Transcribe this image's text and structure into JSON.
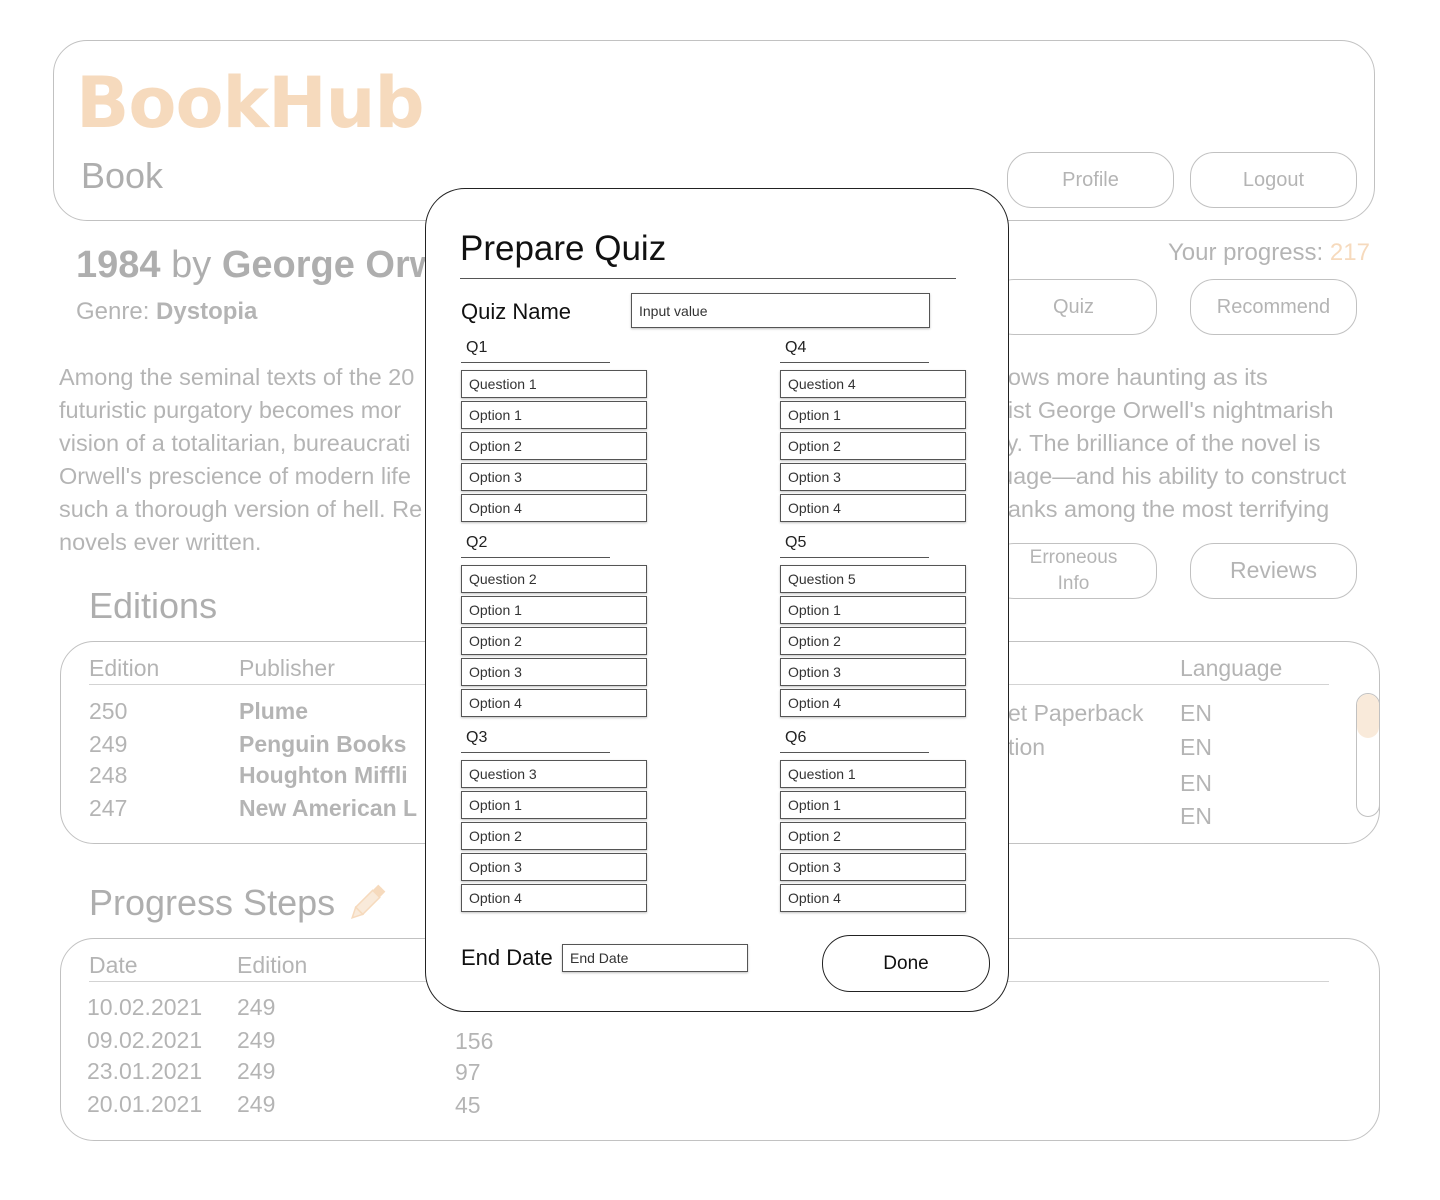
{
  "app": {
    "logo": "BookHub",
    "subtitle": "Book"
  },
  "header": {
    "profile_label": "Profile",
    "logout_label": "Logout"
  },
  "book": {
    "title": "1984",
    "by": "by",
    "author": "George Orw",
    "genre_label": "Genre:",
    "genre": "Dystopia",
    "progress_label": "Your progress:",
    "progress_value": "217",
    "description": [
      "Among the seminal texts of the 20",
      "futuristic purgatory becomes mor",
      "vision of a totalitarian, bureaucrati",
      "Orwell's prescience of modern life",
      "such a thorough version of hell. Re",
      "novels ever written."
    ],
    "description_right": [
      "rows more haunting as its",
      "rist George Orwell's nightmarish",
      "ty. The brilliance of the novel is",
      "uage—and his ability to construct",
      "ranks among the most terrifying",
      ""
    ]
  },
  "actions": {
    "quiz_label": "Quiz",
    "recommend_label": "Recommend",
    "erroneous_label_1": "Erroneous",
    "erroneous_label_2": "Info",
    "reviews_label": "Reviews"
  },
  "editions": {
    "heading": "Editions",
    "columns": {
      "edition": "Edition",
      "publisher": "Publisher",
      "language": "Language"
    },
    "rows": [
      {
        "edition": "250",
        "publisher": "Plume",
        "format": "et Paperback",
        "language": "EN"
      },
      {
        "edition": "249",
        "publisher": "Penguin Books",
        "format": "tion",
        "language": "EN"
      },
      {
        "edition": "248",
        "publisher": "Houghton Miffli",
        "format": "",
        "language": "EN"
      },
      {
        "edition": "247",
        "publisher": "New American L",
        "format": "",
        "language": "EN"
      }
    ]
  },
  "progress_steps": {
    "heading": "Progress Steps",
    "columns": {
      "date": "Date",
      "edition": "Edition"
    },
    "rows": [
      {
        "date": "10.02.2021",
        "edition": "249",
        "value": ""
      },
      {
        "date": "09.02.2021",
        "edition": "249",
        "value": "156"
      },
      {
        "date": "23.01.2021",
        "edition": "249",
        "value": "97"
      },
      {
        "date": "20.01.2021",
        "edition": "249",
        "value": "45"
      }
    ]
  },
  "modal": {
    "title": "Prepare Quiz",
    "quiz_name_label": "Quiz Name",
    "quiz_name_placeholder": "Input value",
    "questions": [
      {
        "label": "Q1",
        "question": "Question 1",
        "options": [
          "Option 1",
          "Option 2",
          "Option 3",
          "Option 4"
        ]
      },
      {
        "label": "Q2",
        "question": "Question 2",
        "options": [
          "Option 1",
          "Option 2",
          "Option 3",
          "Option 4"
        ]
      },
      {
        "label": "Q3",
        "question": "Question 3",
        "options": [
          "Option 1",
          "Option 2",
          "Option 3",
          "Option 4"
        ]
      },
      {
        "label": "Q4",
        "question": "Question 4",
        "options": [
          "Option 1",
          "Option 2",
          "Option 3",
          "Option 4"
        ]
      },
      {
        "label": "Q5",
        "question": "Question 5",
        "options": [
          "Option 1",
          "Option 2",
          "Option 3",
          "Option 4"
        ]
      },
      {
        "label": "Q6",
        "question": "Question 1",
        "options": [
          "Option 1",
          "Option 2",
          "Option 3",
          "Option 4"
        ]
      }
    ],
    "end_date_label": "End Date",
    "end_date_placeholder": "End Date",
    "done_label": "Done"
  },
  "colors": {
    "accent": "#e89a4a",
    "scroll_thumb": "#f1c79b"
  },
  "icons": {
    "progress_edit": "pencil-icon"
  }
}
